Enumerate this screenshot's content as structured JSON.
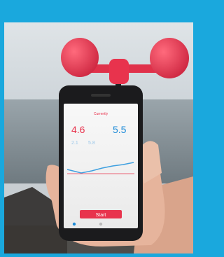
{
  "photo": {
    "subject": "wind-meter-on-smartphone",
    "colors": {
      "border": "#1aa8dd",
      "sky": "#cfd6db",
      "sea": "#7e8b93",
      "cups": "#e8334d",
      "phone": "#1b1b1d",
      "skin": "#e9b9a0"
    }
  },
  "app": {
    "header": "Currently",
    "speed_value": "4.6",
    "gust_value": "5.5",
    "sub_left": "2.1",
    "sub_right": "5.8",
    "button_label": "Start"
  }
}
